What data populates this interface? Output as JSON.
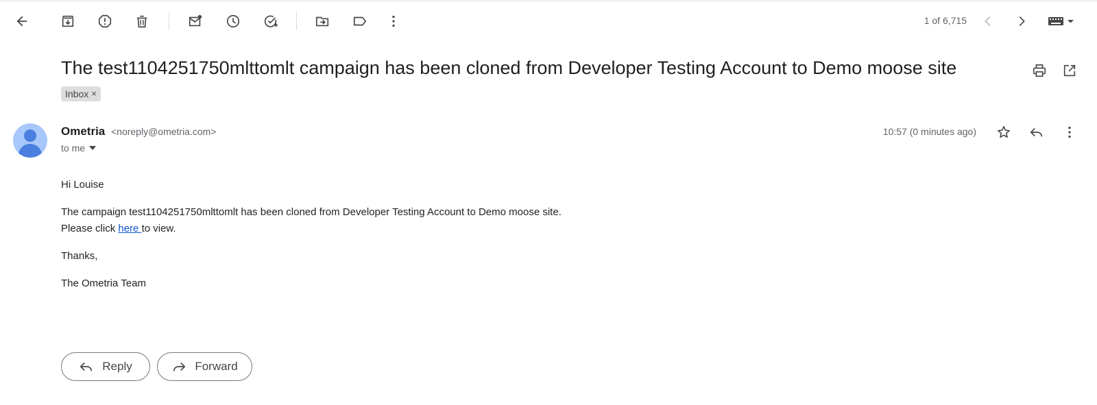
{
  "toolbar": {
    "icons": [
      "back-arrow-icon",
      "archive-icon",
      "report-spam-icon",
      "delete-icon",
      "mark-unread-icon",
      "snooze-icon",
      "add-to-tasks-icon",
      "move-to-icon",
      "labels-icon",
      "more-vert-icon"
    ],
    "pager": "1 of 6,715",
    "input_tool": "keyboard-icon"
  },
  "email": {
    "subject": "The test1104251750mlttomlt campaign has been cloned from Developer Testing Account to Demo moose site",
    "label_chip": "Inbox",
    "label_remove": "×",
    "sender_name": "Ometria",
    "sender_email": "<noreply@ometria.com>",
    "recipient": "to me",
    "time": "10:57 (0 minutes ago)",
    "body": {
      "greeting": "Hi Louise",
      "line1": "The campaign test1104251750mlttomlt has been cloned from Developer Testing Account to Demo moose site.",
      "line2_prefix": "Please click ",
      "link": "here ",
      "line2_suffix": "to view.",
      "thanks": "Thanks,",
      "signature": "The Ometria Team"
    }
  },
  "actions": {
    "reply": "Reply",
    "forward": "Forward"
  },
  "colors": {
    "link": "#1155cc",
    "avatar_bg": "#a8c7fa",
    "avatar_fg": "#4a7fe0",
    "chip_bg": "#dddddd",
    "icon": "#444746"
  }
}
